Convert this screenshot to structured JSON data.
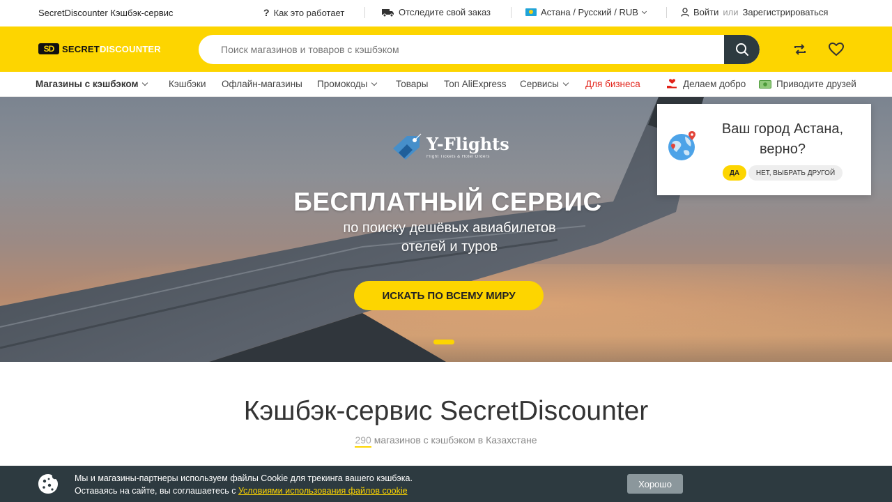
{
  "topbar": {
    "brand": "SecretDiscounter Кэшбэк-сервис",
    "how_it_works": "Как это работает",
    "track_order": "Отследите свой заказ",
    "locale": "Астана / Русский / RUB",
    "login": "Войти",
    "or": "или",
    "register": "Зарегистрироваться"
  },
  "header": {
    "logo_mark": "SD",
    "logo_text_dark": "SECRET",
    "logo_text_light": "DISCOUNTER",
    "search_placeholder": "Поиск магазинов и товаров с кэшбэком"
  },
  "nav": {
    "items": [
      {
        "label": "Магазины с кэшбэком"
      },
      {
        "label": "Кэшбэки"
      },
      {
        "label": "Офлайн-магазины"
      },
      {
        "label": "Промокоды"
      },
      {
        "label": "Товары"
      },
      {
        "label": "Топ AliExpress"
      },
      {
        "label": "Сервисы"
      },
      {
        "label": "Для бизнеса"
      },
      {
        "label": "Делаем добро"
      },
      {
        "label": "Приводите друзей"
      }
    ]
  },
  "hero": {
    "brand_name": "Y-Flights",
    "brand_tagline": "Flight Tickets & Hotel Orders",
    "title": "БЕСПЛАТНЫЙ СЕРВИС",
    "subtitle_line1": "по поиску дешёвых авиабилетов",
    "subtitle_line2": "отелей и туров",
    "cta": "ИСКАТЬ ПО ВСЕМУ МИРУ"
  },
  "city_popup": {
    "question_line1": "Ваш город Астана,",
    "question_line2": "верно?",
    "yes": "ДА",
    "no": "НЕТ, ВЫБРАТЬ ДРУГОЙ"
  },
  "main": {
    "title": "Кэшбэк-сервис SecretDiscounter",
    "store_count": "290",
    "subtitle_rest": " магазинов с кэшбэком в Казахстане"
  },
  "cookie": {
    "line1": "Мы и магазины-партнеры используем файлы Cookie для трекинга вашего кэшбэка.",
    "line2_prefix": "Оставаясь на сайте, вы соглашаетесь с ",
    "link": "Условиями использования файлов cookie",
    "button": "Хорошо"
  },
  "colors": {
    "brand_yellow": "#fdd500",
    "dark": "#2d3a40",
    "business_red": "#e2231a"
  }
}
